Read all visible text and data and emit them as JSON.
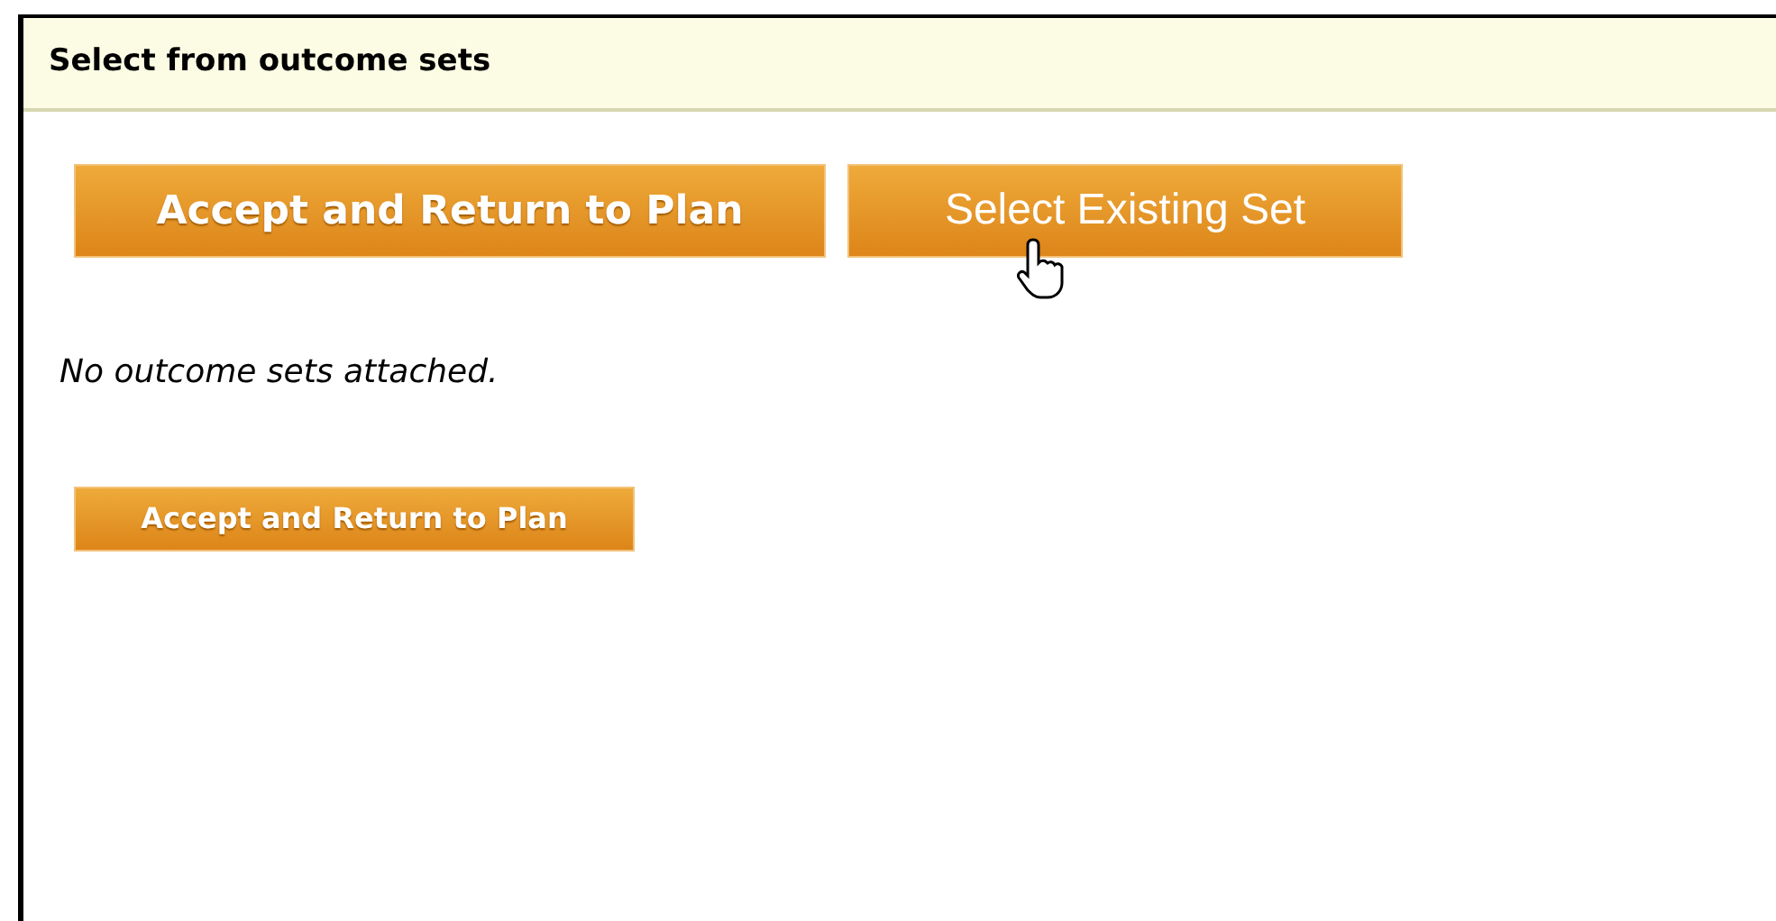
{
  "panel": {
    "title": "Select from outcome sets"
  },
  "top_buttons": [
    {
      "label": "Accept and Return to Plan",
      "kind": "bold"
    },
    {
      "label": "Select Existing Set",
      "kind": "plain"
    }
  ],
  "message": "No outcome sets attached.",
  "bottom_button": {
    "label": "Accept and Return to Plan"
  }
}
